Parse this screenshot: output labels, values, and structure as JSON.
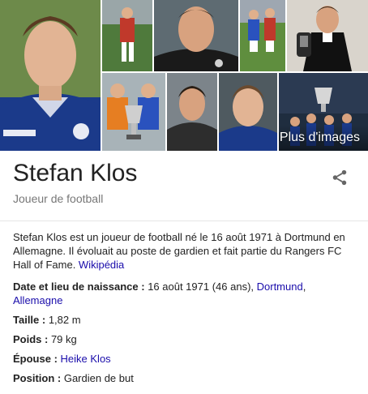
{
  "gallery": {
    "more_label": "Plus d'images",
    "photos": [
      {
        "icon": "portrait-photo"
      },
      {
        "icon": "goalkeeper-action-photo"
      },
      {
        "icon": "goalkeeper-headshot-photo"
      },
      {
        "icon": "players-on-pitch-photo"
      },
      {
        "icon": "award-ceremony-photo"
      },
      {
        "icon": "trophy-celebration-photo"
      },
      {
        "icon": "casual-portrait-photo"
      },
      {
        "icon": "young-portrait-photo"
      },
      {
        "icon": "stadium-trophy-photo"
      }
    ]
  },
  "header": {
    "title": "Stefan Klos",
    "subtitle": "Joueur de football",
    "share_icon": "share-icon"
  },
  "description": {
    "text": "Stefan Klos est un joueur de football né le 16 août 1971 à Dortmund en Allemagne. Il évoluait au poste de gardien et fait partie du Rangers FC Hall of Fame. ",
    "source_link": "Wikipédia"
  },
  "facts": {
    "birth": {
      "label": "Date et lieu de naissance :",
      "value": " 16 août 1971 (46 ans), ",
      "link1": "Dortmund",
      "sep": ", ",
      "link2": "Allemagne"
    },
    "height": {
      "label": "Taille :",
      "value": " 1,82 m"
    },
    "weight": {
      "label": "Poids :",
      "value": " 79 kg"
    },
    "spouse": {
      "label": "Épouse :",
      "value": " ",
      "link": "Heike Klos"
    },
    "position": {
      "label": "Position :",
      "value": " Gardien de but"
    }
  },
  "colors": {
    "link": "#1a0dab",
    "title": "#222222",
    "subtitle": "#777777",
    "rangers_blue": "#1b3a8a"
  }
}
